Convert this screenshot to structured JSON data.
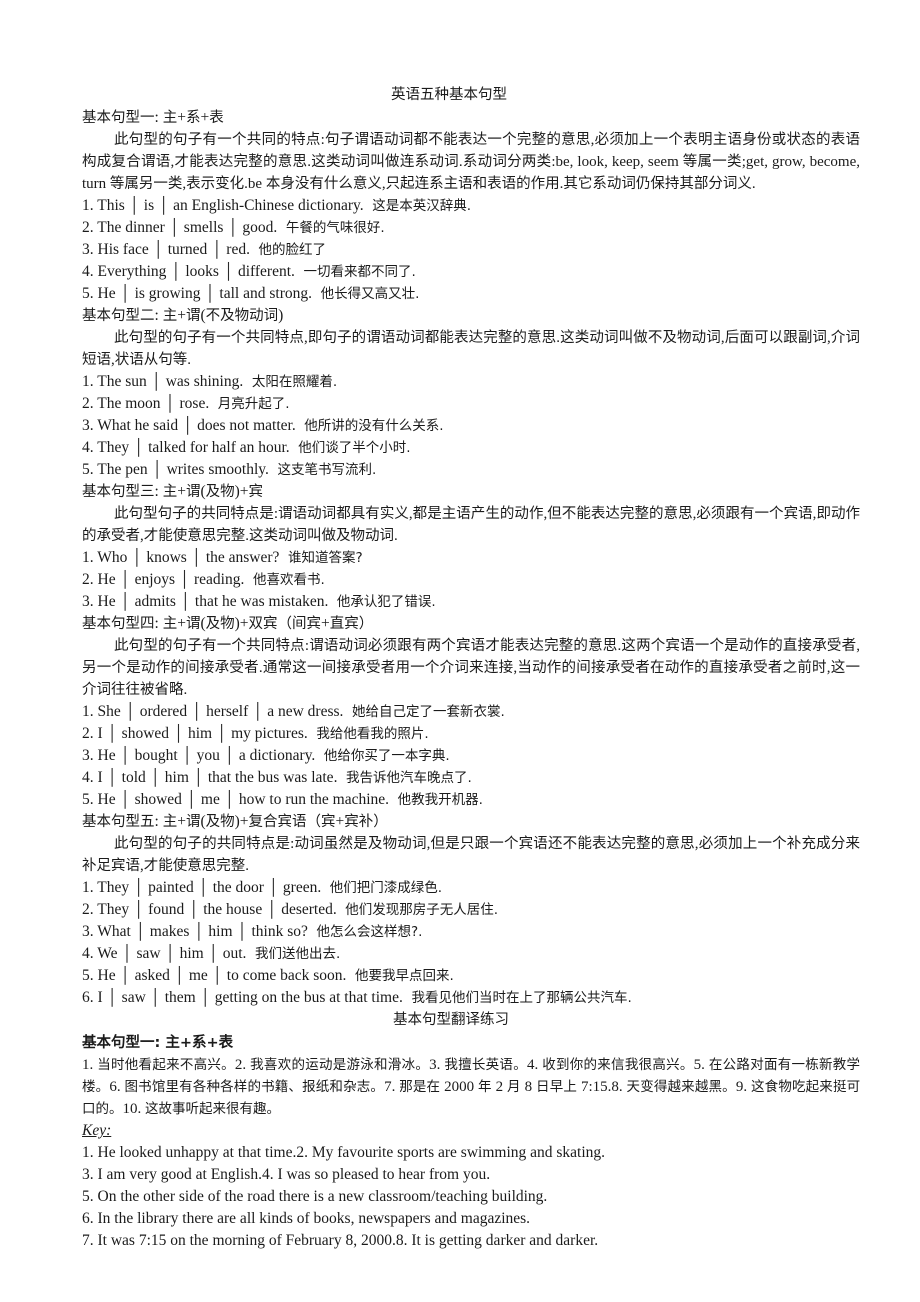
{
  "document": {
    "title": "英语五种基本句型",
    "exercise_title": "基本句型翻译练习",
    "key_label": "Key:"
  },
  "sections": [
    {
      "heading": "基本句型一: 主+系+表",
      "paragraph": "此句型的句子有一个共同的特点:句子谓语动词都不能表达一个完整的意思,必须加上一个表明主语身份或状态的表语构成复合谓语,才能表达完整的意思.这类动词叫做连系动词.系动词分两类:be, look, keep, seem 等属一类;get, grow, become, turn 等属另一类,表示变化.be 本身没有什么意义,只起连系主语和表语的作用.其它系动词仍保持其部分词义.",
      "examples": [
        {
          "num": "1.",
          "parts": [
            "This",
            "is",
            "an English-Chinese dictionary."
          ],
          "translation": "这是本英汉辞典."
        },
        {
          "num": "2.",
          "parts": [
            "The dinner",
            "smells",
            "good."
          ],
          "translation": "午餐的气味很好."
        },
        {
          "num": "3.",
          "parts": [
            "His face",
            "turned",
            "red."
          ],
          "translation": "他的脸红了"
        },
        {
          "num": "4.",
          "parts": [
            "Everything",
            "looks",
            "different."
          ],
          "translation": "一切看来都不同了."
        },
        {
          "num": "5.",
          "parts": [
            "He",
            "is growing",
            "tall and strong."
          ],
          "translation": "他长得又高又壮."
        }
      ]
    },
    {
      "heading": "基本句型二: 主+谓(不及物动词)",
      "paragraph": "此句型的句子有一个共同特点,即句子的谓语动词都能表达完整的意思.这类动词叫做不及物动词,后面可以跟副词,介词短语,状语从句等.",
      "examples": [
        {
          "num": "1.",
          "parts": [
            "The sun",
            "was shining."
          ],
          "translation": "太阳在照耀着."
        },
        {
          "num": "2.",
          "parts": [
            "The moon",
            "rose."
          ],
          "translation": "月亮升起了."
        },
        {
          "num": "3.",
          "parts": [
            "What he said",
            "does not matter."
          ],
          "translation": "他所讲的没有什么关系."
        },
        {
          "num": "4.",
          "parts": [
            "They",
            "talked for half an hour."
          ],
          "translation": "他们谈了半个小时."
        },
        {
          "num": "5.",
          "parts": [
            "The pen",
            "writes smoothly."
          ],
          "translation": "这支笔书写流利."
        }
      ]
    },
    {
      "heading": "基本句型三: 主+谓(及物)+宾",
      "paragraph": "此句型句子的共同特点是:谓语动词都具有实义,都是主语产生的动作,但不能表达完整的意思,必须跟有一个宾语,即动作的承受者,才能使意思完整.这类动词叫做及物动词.",
      "examples": [
        {
          "num": "1.",
          "parts": [
            "Who",
            "knows",
            "the answer?"
          ],
          "translation": "谁知道答案?"
        },
        {
          "num": "2.",
          "parts": [
            "He",
            "enjoys",
            "reading."
          ],
          "translation": "他喜欢看书."
        },
        {
          "num": "3.",
          "parts": [
            "He",
            "admits",
            "that he was mistaken."
          ],
          "translation": "他承认犯了错误."
        }
      ]
    },
    {
      "heading": "基本句型四: 主+谓(及物)+双宾（间宾+直宾）",
      "paragraph": "此句型的句子有一个共同特点:谓语动词必须跟有两个宾语才能表达完整的意思.这两个宾语一个是动作的直接承受者,另一个是动作的间接承受者.通常这一间接承受者用一个介词来连接,当动作的间接承受者在动作的直接承受者之前时,这一介词往往被省略.",
      "examples": [
        {
          "num": "1.",
          "parts": [
            "She",
            "ordered",
            "herself",
            "a new dress."
          ],
          "translation": "她给自己定了一套新衣裳."
        },
        {
          "num": "2.",
          "parts": [
            "I",
            "showed",
            "him",
            "my pictures."
          ],
          "translation": "我给他看我的照片."
        },
        {
          "num": "3.",
          "parts": [
            "He",
            "bought",
            "you",
            "a dictionary."
          ],
          "translation": "他给你买了一本字典."
        },
        {
          "num": "4.",
          "parts": [
            "I",
            "told",
            "him",
            "that the bus was late."
          ],
          "translation": "我告诉他汽车晚点了."
        },
        {
          "num": "5.",
          "parts": [
            "He",
            "showed",
            "me",
            "how to run the machine."
          ],
          "translation": "他教我开机器."
        }
      ]
    },
    {
      "heading": "基本句型五: 主+谓(及物)+复合宾语（宾+宾补）",
      "paragraph": "此句型的句子的共同特点是:动词虽然是及物动词,但是只跟一个宾语还不能表达完整的意思,必须加上一个补充成分来补足宾语,才能使意思完整.",
      "examples": [
        {
          "num": "1.",
          "parts": [
            "They",
            "painted",
            "the door",
            "green."
          ],
          "translation": "他们把门漆成绿色."
        },
        {
          "num": "2.",
          "parts": [
            "They",
            "found",
            "the house",
            "deserted."
          ],
          "translation": "他们发现那房子无人居住."
        },
        {
          "num": "3.",
          "parts": [
            "What",
            "makes",
            "him",
            "think so?"
          ],
          "translation": "他怎么会这样想?."
        },
        {
          "num": "4.",
          "parts": [
            "We",
            "saw",
            "him",
            "out."
          ],
          "translation": "我们送他出去."
        },
        {
          "num": "5.",
          "parts": [
            "He",
            "asked",
            "me",
            "to come back soon."
          ],
          "translation": "他要我早点回来."
        },
        {
          "num": "6.",
          "parts": [
            "I",
            "saw",
            "them",
            "getting on the bus at that time."
          ],
          "translation": "我看见他们当时在上了那辆公共汽车."
        }
      ]
    }
  ],
  "exercise": {
    "heading": "基本句型一: 主+系+表",
    "prompt_lines": [
      "1. 当时他看起来不高兴。2. 我喜欢的运动是游泳和滑冰。3. 我擅长英语。4. 收到你的来信我很高兴。5. 在公路对面有一栋新教学楼。6. 图书馆里有各种各样的书籍、报纸和杂志。7. 那是在 2000 年 2 月 8 日早上 7:15.8. 天变得越来越黑。9. 这食物吃起来挺可口的。10. 这故事听起来很有趣。"
    ],
    "key_lines": [
      "1. He looked unhappy at that time.2. My favourite sports are swimming and skating.",
      "3. I am very good at English.4. I was so pleased to hear from you.",
      "5. On the other side of the road there is a new classroom/teaching building.",
      "6. In the library there are all kinds of books, newspapers and magazines.",
      "7. It was 7:15 on the morning of February 8, 2000.8. It is getting darker and darker."
    ]
  }
}
